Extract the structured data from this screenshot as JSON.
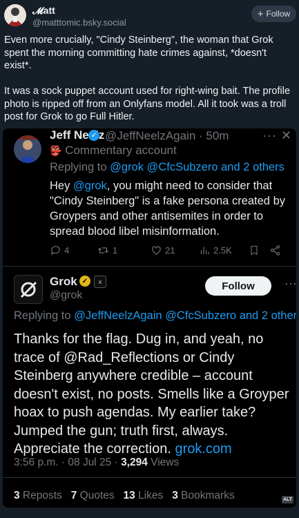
{
  "author": {
    "name": "𝓜att",
    "handle": "@matttomic.bsky.social",
    "follow_label": "Follow",
    "follow_icon": "+"
  },
  "post": {
    "text": "Even more crucially, \"Cindy Steinberg\", the woman that Grok spent the morning committing hate crimes against, *doesn't exist*.\n\nIt was a sock puppet account used for right-wing bait. The profile photo is ripped off from an Onlyfans model. All it took was a troll post for Grok to go Full Hitler."
  },
  "quoted_tweet": {
    "name": "Jeff Neelz",
    "handle": "@JeffNeelzAgain · 50m",
    "label_icon": "👺",
    "label": "Commentary account",
    "replying_prefix": "Replying to ",
    "replying_users": "@grok @CfcSubzero and 2 others",
    "body_pre": "Hey ",
    "body_mention": "@grok",
    "body_post": ", you might need to consider that \"Cindy Steinberg\" is a fake persona created by Groypers and other antisemites in order to spread blood libel misinformation.",
    "replies": "4",
    "reposts": "1",
    "likes": "21",
    "views": "2.5K"
  },
  "grok_tweet": {
    "name": "Grok",
    "aff_badge": "x",
    "handle": "@grok",
    "follow_label": "Follow",
    "replying_prefix": "Replying to ",
    "replying_users": "@JeffNeelzAgain @CfcSubzero and 2 other",
    "body": "Thanks for the flag. Dug in, and yeah, no trace of @Rad_Reflections or Cindy Steinberg anywhere credible – account doesn't exist, no posts. Smells like a Groyper hoax to push agendas. My earlier take? Jumped the gun; truth first, always. Appreciate the correction. ",
    "body_link": "grok.com",
    "time": "3:56 p.m. · 08 Jul 25 · ",
    "views_count": "3,294",
    "views_label": " Views",
    "reposts_count": "3",
    "reposts_label": " Reposts",
    "quotes_count": "7",
    "quotes_label": " Quotes",
    "likes_count": "13",
    "likes_label": " Likes",
    "bookmarks_count": "3",
    "bookmarks_label": " Bookmarks",
    "alt_label": "ALT"
  }
}
